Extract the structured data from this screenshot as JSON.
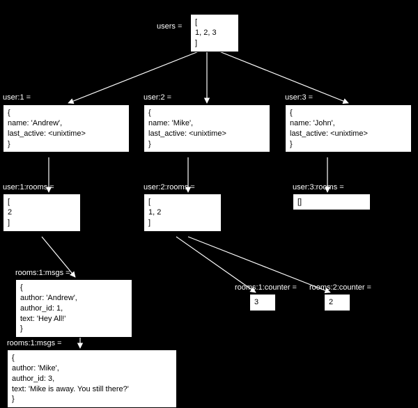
{
  "labels": {
    "users": "users = ",
    "user1": "user:1 = ",
    "user2": "user:2 = ",
    "user3": "user:3 = ",
    "rooms1": "user:1:rooms = ",
    "rooms2": "user:2:rooms = ",
    "rooms3": "user:3:rooms = ",
    "msg1_1": "rooms:1:msgs = ",
    "msg1_2": "rooms:1:msgs = ",
    "count1": "rooms:1:counter = ",
    "count2": "rooms:2:counter = "
  },
  "boxes": {
    "users": "[\n1, 2, 3\n]",
    "user1": "{\nname: 'Andrew',\nlast_active: <unixtime>\n}",
    "user2": "{\nname: 'Mike',\nlast_active: <unixtime>\n}",
    "user3": "{\nname: 'John',\nlast_active: <unixtime>\n}",
    "rooms1": "[\n2\n]",
    "rooms2": "[\n1, 2\n]",
    "rooms3": "[]",
    "msg1_1": "{\nauthor: 'Andrew',\nauthor_id: 1,\ntext: 'Hey All!'\n}",
    "msg1_2": "{\nauthor: 'Mike',\nauthor_id: 3,\ntext: 'Mike is away. You still there?'\n}",
    "count1": "3",
    "count2": "2"
  }
}
